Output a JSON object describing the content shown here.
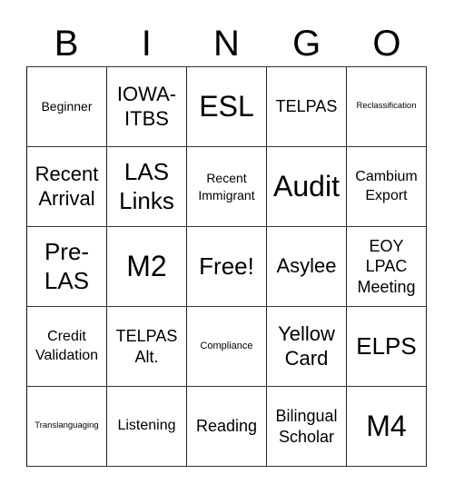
{
  "header": [
    "B",
    "I",
    "N",
    "G",
    "O"
  ],
  "board": [
    [
      "Beginner",
      "IOWA-ITBS",
      "ESL",
      "TELPAS",
      "Reclassification"
    ],
    [
      "Recent Arrival",
      "LAS Links",
      "Recent Immigrant",
      "Audit",
      "Cambium Export"
    ],
    [
      "Pre-LAS",
      "M2",
      "Free!",
      "Asylee",
      "EOY LPAC Meeting"
    ],
    [
      "Credit Validation",
      "TELPAS Alt.",
      "Compliance",
      "Yellow Card",
      "ELPS"
    ],
    [
      "Translanguaging",
      "Listening",
      "Reading",
      "Bilingual Scholar",
      "M4"
    ]
  ]
}
